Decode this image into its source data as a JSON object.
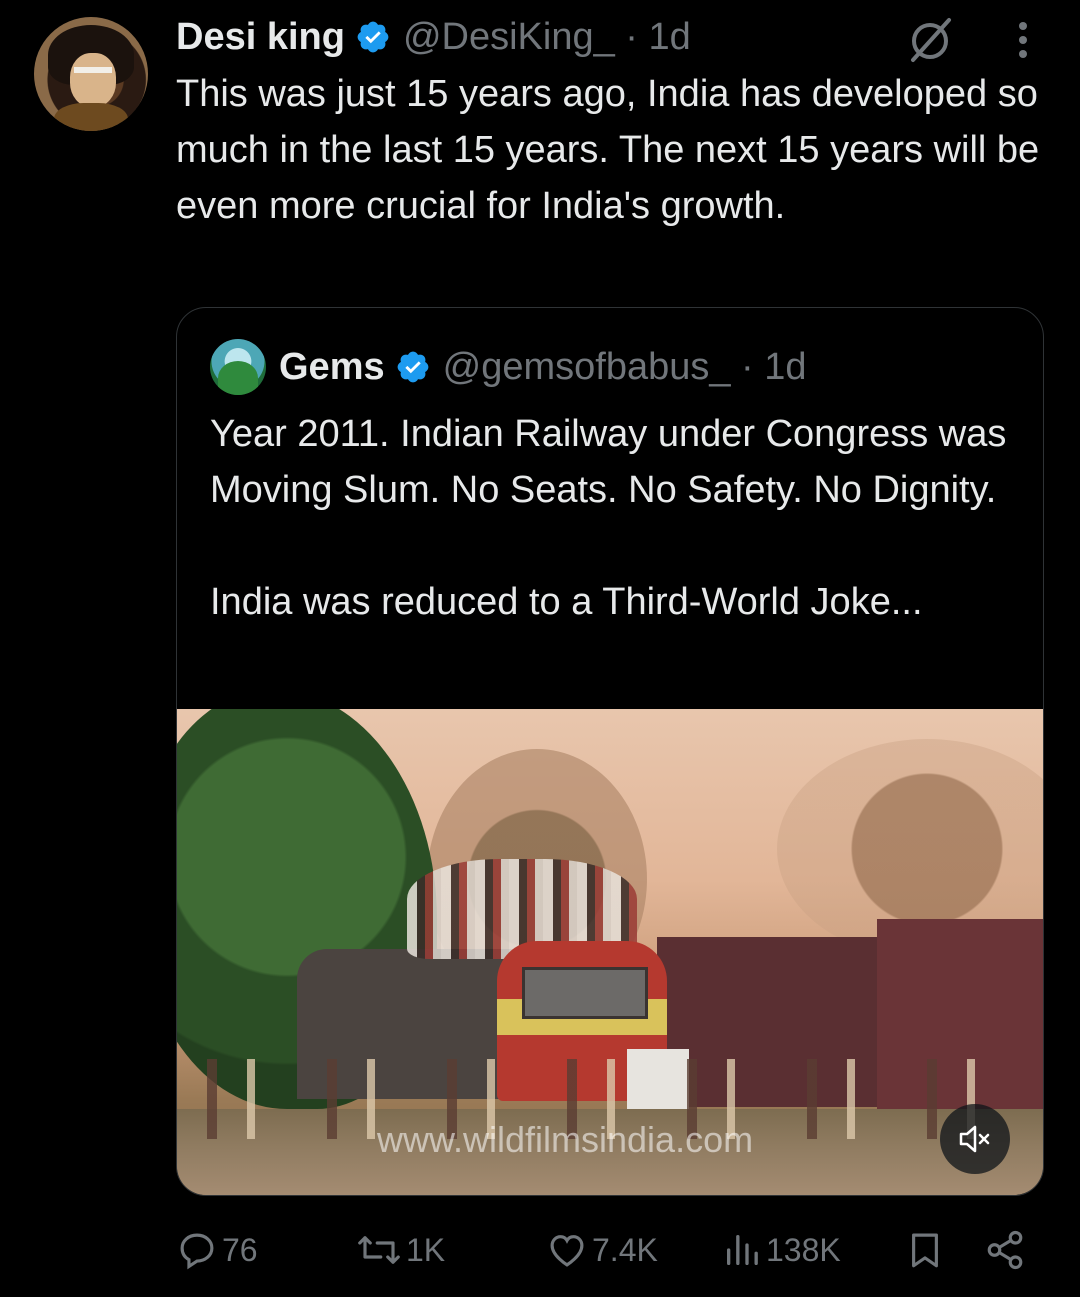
{
  "tweet": {
    "author_name": "Desi king",
    "author_handle_time": "@DesiKing_ · 1d",
    "text": "This was just 15 years ago, India has developed so much in the last 15 years. The next 15 years will be even more crucial for India's growth."
  },
  "quote": {
    "author_name": "Gems",
    "author_handle_time": "@gemsofbabus_ · 1d",
    "lines": [
      "Year 2011. Indian Railway under Congress was Moving Slum. No Seats. No Safety. No Dignity.",
      "India was reduced to a Third-World Joke..."
    ],
    "media": {
      "watermark": "www.wildfilmsindia.com",
      "mute_icon": "speaker-muted-icon"
    }
  },
  "actions": {
    "replies": "76",
    "reposts": "1K",
    "likes": "7.4K",
    "views": "138K"
  },
  "icons": {
    "verified": "verified-badge-icon",
    "grok": "grok-icon",
    "more": "more-vertical-icon",
    "reply": "reply-icon",
    "repost": "repost-icon",
    "like": "heart-icon",
    "views": "views-chart-icon",
    "bookmark": "bookmark-icon",
    "share": "share-icon"
  },
  "colors": {
    "background": "#000000",
    "text": "#e7e9ea",
    "muted": "#71767b",
    "verified_blue": "#1d9bf0",
    "border": "#2f3336"
  }
}
